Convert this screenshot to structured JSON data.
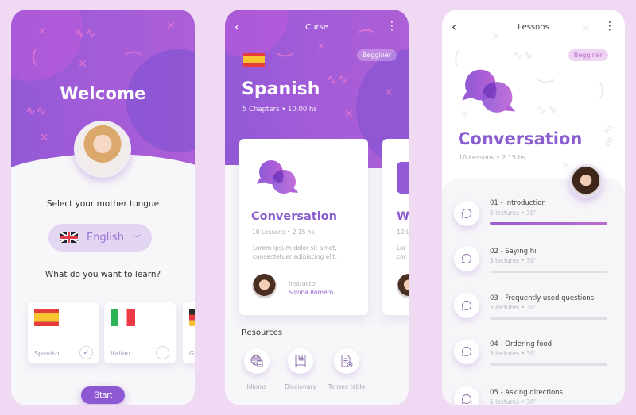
{
  "colors": {
    "background": "#efd9f3",
    "accent": "#8b5ed0",
    "gradient_start": "#9259d6",
    "gradient_end": "#ac5fd6",
    "badge_bg": "#efd4f3"
  },
  "screen1": {
    "title": "Welcome",
    "mother_tongue_label": "Select your mother tongue",
    "mother_tongue_select": {
      "value": "English",
      "flag": "uk-flag-icon"
    },
    "learn_label": "What do you want to learn?",
    "languages": [
      {
        "name": "Spanish",
        "flag": "spain-flag-icon",
        "selected": true,
        "check": "✓"
      },
      {
        "name": "Italian",
        "flag": "italy-flag-icon",
        "selected": false,
        "check": ""
      },
      {
        "name": "G",
        "flag": "germany-flag-icon",
        "selected": false,
        "check": ""
      }
    ],
    "start_label": "Start"
  },
  "screen2": {
    "topbar_title": "Curse",
    "back_icon": "‹",
    "menu_icon": "⋮",
    "level_badge": "Begginer",
    "course_title": "Spanish",
    "course_meta": "5 Chapters   •   10.00 hs",
    "cards": [
      {
        "title": "Conversation",
        "meta": "10 Lessons   •   2.15 hs",
        "description": "Lorem ipsum dolor sit amet, consectetuer adipiscing elit,",
        "instructor_label": "Instructor",
        "instructor_name": "Silvina Romero"
      },
      {
        "title": "W",
        "meta": "10 L",
        "description": "Lor\ncor"
      }
    ],
    "resources_title": "Resources",
    "resources": [
      {
        "label": "Idioms",
        "icon": "globe-document-icon"
      },
      {
        "label": "Diccionary",
        "icon": "book-icon"
      },
      {
        "label": "Tenses table",
        "icon": "document-add-icon"
      }
    ]
  },
  "screen3": {
    "topbar_title": "Lessons",
    "back_icon": "‹",
    "menu_icon": "⋮",
    "level_badge": "Begginer",
    "title": "Conversation",
    "meta": "10 Lessons   •   2.15 hs",
    "lessons": [
      {
        "title": "01 - Introduction",
        "meta": "5 lectures   •   30'",
        "progress": 1.0
      },
      {
        "title": "02 - Saying hi",
        "meta": "5 lectures   •   30'",
        "progress": 0
      },
      {
        "title": "03 - Frequently used questions",
        "meta": "5 lectures   •   30'",
        "progress": 0
      },
      {
        "title": "04 - Ordering food",
        "meta": "5 lectures   •   30'",
        "progress": 0
      },
      {
        "title": "05 - Asking directions",
        "meta": "5 lectures   •   30'",
        "progress": 0
      }
    ]
  }
}
